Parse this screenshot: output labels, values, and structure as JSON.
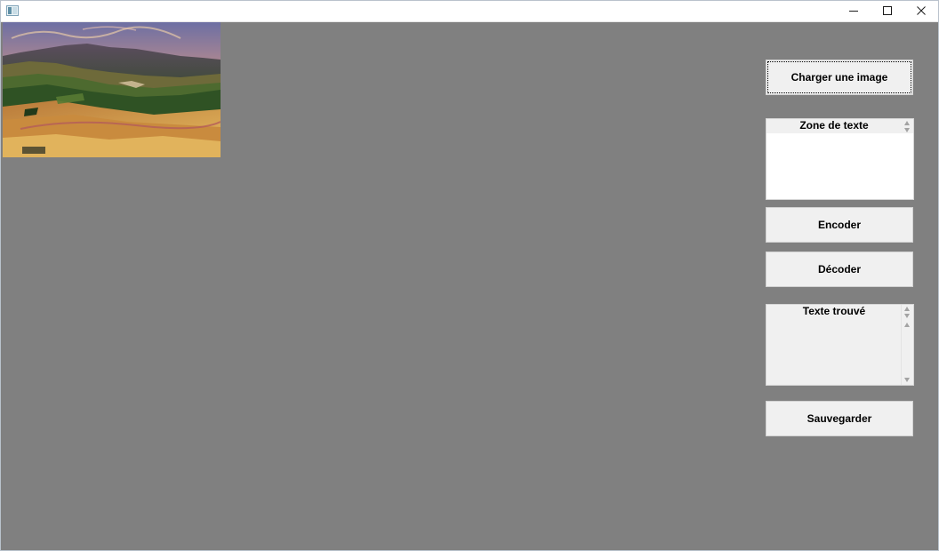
{
  "window": {
    "background_color": "#808080",
    "controls": {
      "minimize": "minimize-icon",
      "maximize": "maximize-icon",
      "close": "close-icon"
    }
  },
  "image": {
    "description_icon": "landscape-image"
  },
  "buttons": {
    "load": "Charger une image",
    "encode": "Encoder",
    "decode": "Décoder",
    "save": "Sauvegarder"
  },
  "input_box": {
    "label": "Zone de texte",
    "value": ""
  },
  "output_box": {
    "label": "Texte trouvé",
    "value": ""
  }
}
